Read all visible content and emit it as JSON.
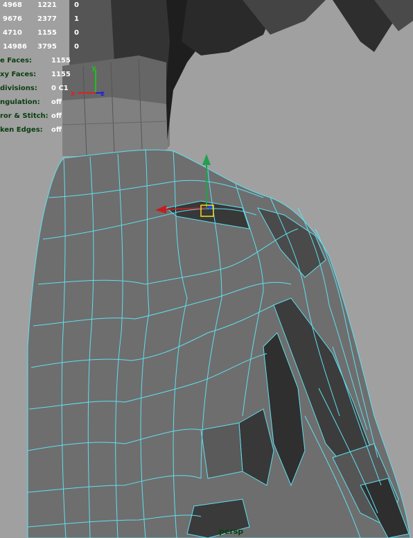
{
  "hud": {
    "stats_rows": [
      [
        "4968",
        "1221",
        "0"
      ],
      [
        "9676",
        "2377",
        "1"
      ],
      [
        "4710",
        "1155",
        "0"
      ],
      [
        "14986",
        "3795",
        "0"
      ]
    ],
    "settings": [
      {
        "label": "e Faces:",
        "value": "1155"
      },
      {
        "label": "xy Faces:",
        "value": "1155"
      },
      {
        "label": "divisions:",
        "value": "0 C1"
      },
      {
        "label": "ngulation:",
        "value": "off"
      },
      {
        "label": "ror & Stitch:",
        "value": "off"
      },
      {
        "label": "ken Edges:",
        "value": "off"
      }
    ]
  },
  "axis": {
    "x": "x",
    "y": "y",
    "z": "z"
  },
  "camera": "persp",
  "colors": {
    "background": "#a0a0a0",
    "wireframe": "#5fe0f0",
    "hud_label": "#0a3d10",
    "axis_x": "#e02020",
    "axis_y": "#20c020",
    "axis_z": "#2020e0",
    "selection": "#f0e020"
  }
}
